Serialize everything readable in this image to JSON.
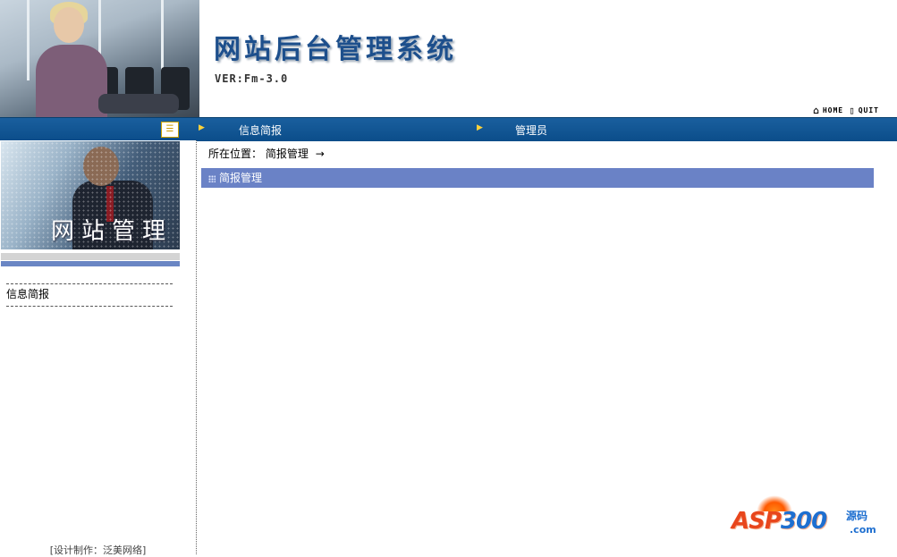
{
  "header": {
    "title": "网站后台管理系统",
    "version": "VER:Fm-3.0",
    "links": [
      {
        "label": "HOME",
        "icon": "home-icon"
      },
      {
        "label": "QUIT",
        "icon": "quit-icon"
      }
    ]
  },
  "nav": {
    "section": "信息简报",
    "user": "管理员"
  },
  "sidebar": {
    "banner_label": "网站管理",
    "items": [
      {
        "label": "信息简报"
      }
    ],
    "credit": "[设计制作：泛美网络]"
  },
  "main": {
    "location_label": "所在位置：",
    "location_path": "简报管理",
    "location_arrow": "→",
    "panel_title": "简报管理"
  },
  "watermark": {
    "brand_a": "ASP",
    "brand_b": "300",
    "cn": "源码",
    "com": ".com"
  },
  "colors": {
    "nav_bg": "#0b4d8a",
    "panel_bar": "#6a82c6",
    "title": "#1d4f8c"
  }
}
